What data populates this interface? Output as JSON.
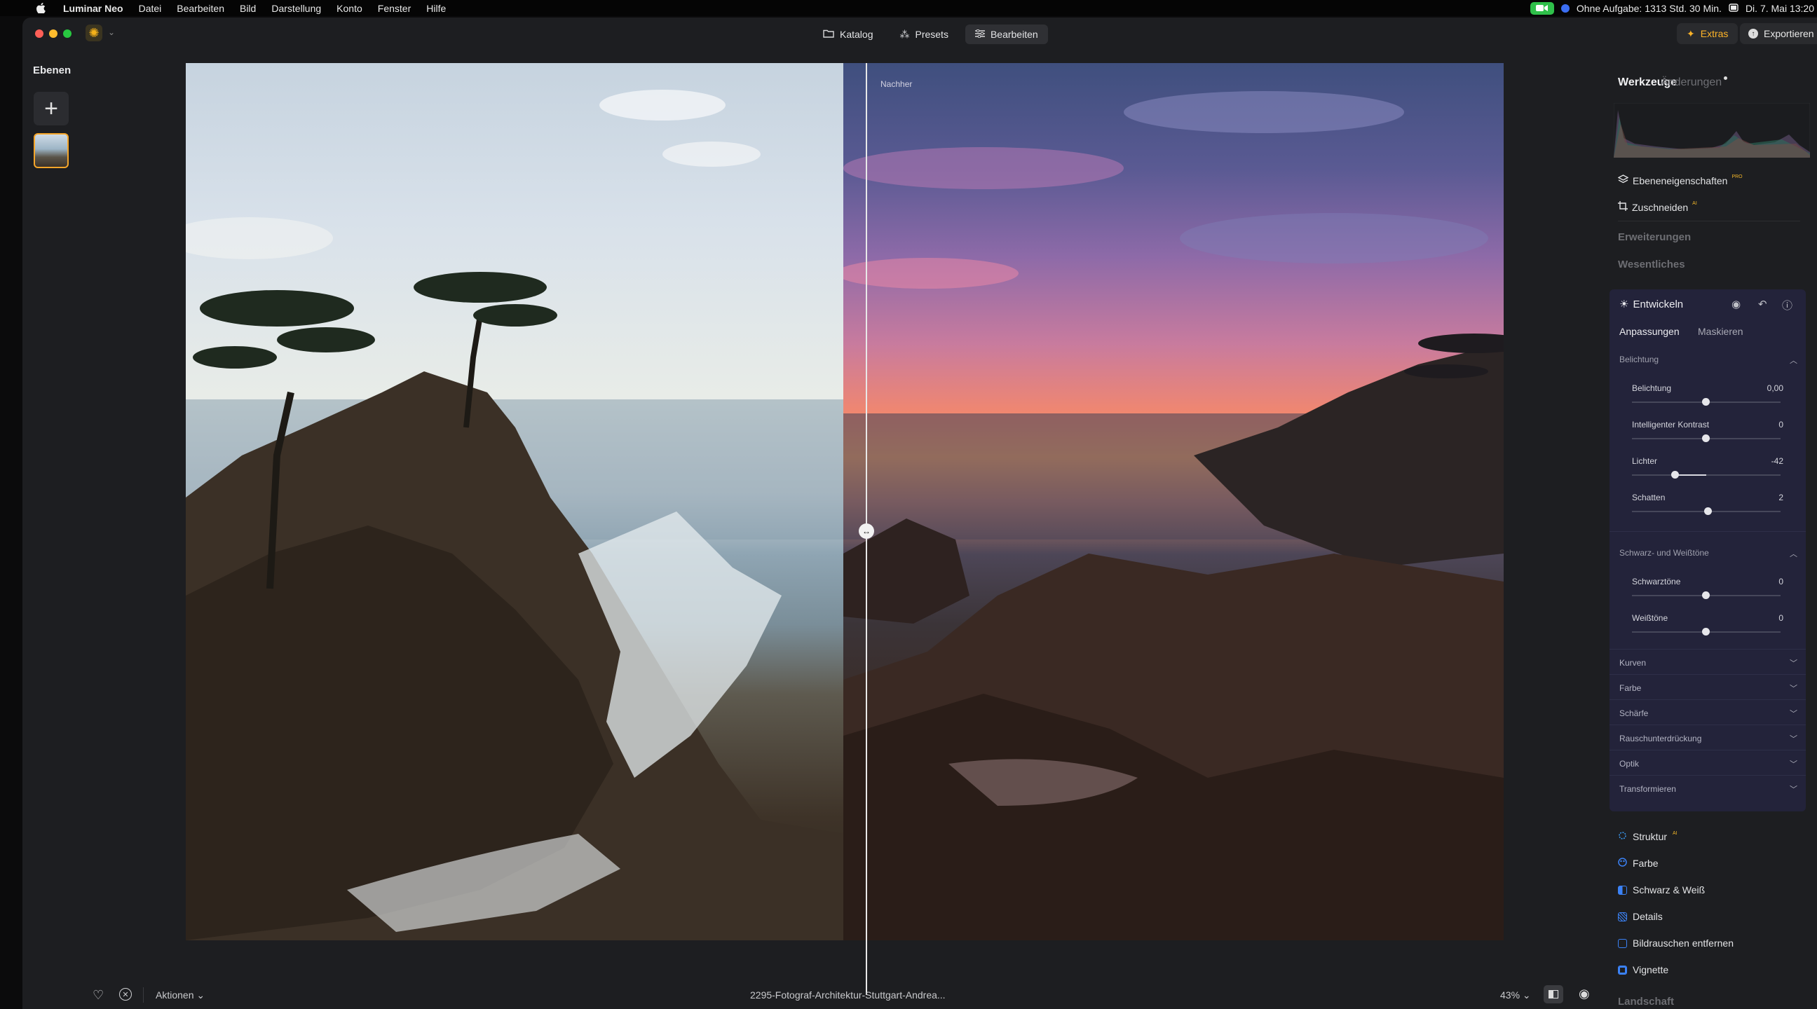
{
  "menubar": {
    "app_name": "Luminar Neo",
    "items": [
      "Datei",
      "Bearbeiten",
      "Bild",
      "Darstellung",
      "Konto",
      "Fenster",
      "Hilfe"
    ],
    "status_text": "Ohne Aufgabe: 1313 Std. 30 Min.",
    "datetime": "Di. 7. Mai  13:20"
  },
  "titlebar": {
    "tabs": [
      {
        "label": "Katalog",
        "icon": "folder-icon"
      },
      {
        "label": "Presets",
        "icon": "sparkle-icon"
      },
      {
        "label": "Bearbeiten",
        "icon": "sliders-icon"
      }
    ],
    "active_tab": "Bearbeiten",
    "extras_label": "Extras",
    "export_label": "Exportieren"
  },
  "layers": {
    "title": "Ebenen"
  },
  "canvas": {
    "after_label": "Nachher",
    "split_fraction": 0.5
  },
  "bottombar": {
    "actions_label": "Aktionen",
    "filename": "2295-Fotograf-Architektur-Stuttgart-Andrea...",
    "zoom": "43%"
  },
  "rightpanel": {
    "tab_tools": "Werkzeuge",
    "tab_changes": "Änderungen",
    "layer_props": "Ebeneneigenschaften",
    "crop": "Zuschneiden",
    "section_extensions": "Erweiterungen",
    "section_essentials": "Wesentliches",
    "develop": {
      "title": "Entwickeln",
      "tab_adjust": "Anpassungen",
      "tab_mask": "Maskieren",
      "group_exposure": "Belichtung",
      "sliders_exposure": [
        {
          "label": "Belichtung",
          "value": "0,00",
          "pos": 0.5
        },
        {
          "label": "Intelligenter Kontrast",
          "value": "0",
          "pos": 0.5
        },
        {
          "label": "Lichter",
          "value": "-42",
          "pos": 0.29
        },
        {
          "label": "Schatten",
          "value": "2",
          "pos": 0.51
        }
      ],
      "group_bw": "Schwarz- und Weißtöne",
      "sliders_bw": [
        {
          "label": "Schwarztöne",
          "value": "0",
          "pos": 0.5
        },
        {
          "label": "Weißtöne",
          "value": "0",
          "pos": 0.5
        }
      ],
      "collapsed": [
        "Kurven",
        "Farbe",
        "Schärfe",
        "Rauschunterdrückung",
        "Optik",
        "Transformieren"
      ]
    },
    "tools": [
      {
        "label": "Struktur",
        "color": "#3b9cf5"
      },
      {
        "label": "Farbe",
        "color": "#3b82f6"
      },
      {
        "label": "Schwarz & Weiß",
        "color": "#3b82f6"
      },
      {
        "label": "Details",
        "color": "#3b82f6"
      },
      {
        "label": "Bildrauschen entfernen",
        "color": "#3b82f6"
      },
      {
        "label": "Vignette",
        "color": "#3b82f6"
      }
    ],
    "section_landscape": "Landschaft"
  }
}
